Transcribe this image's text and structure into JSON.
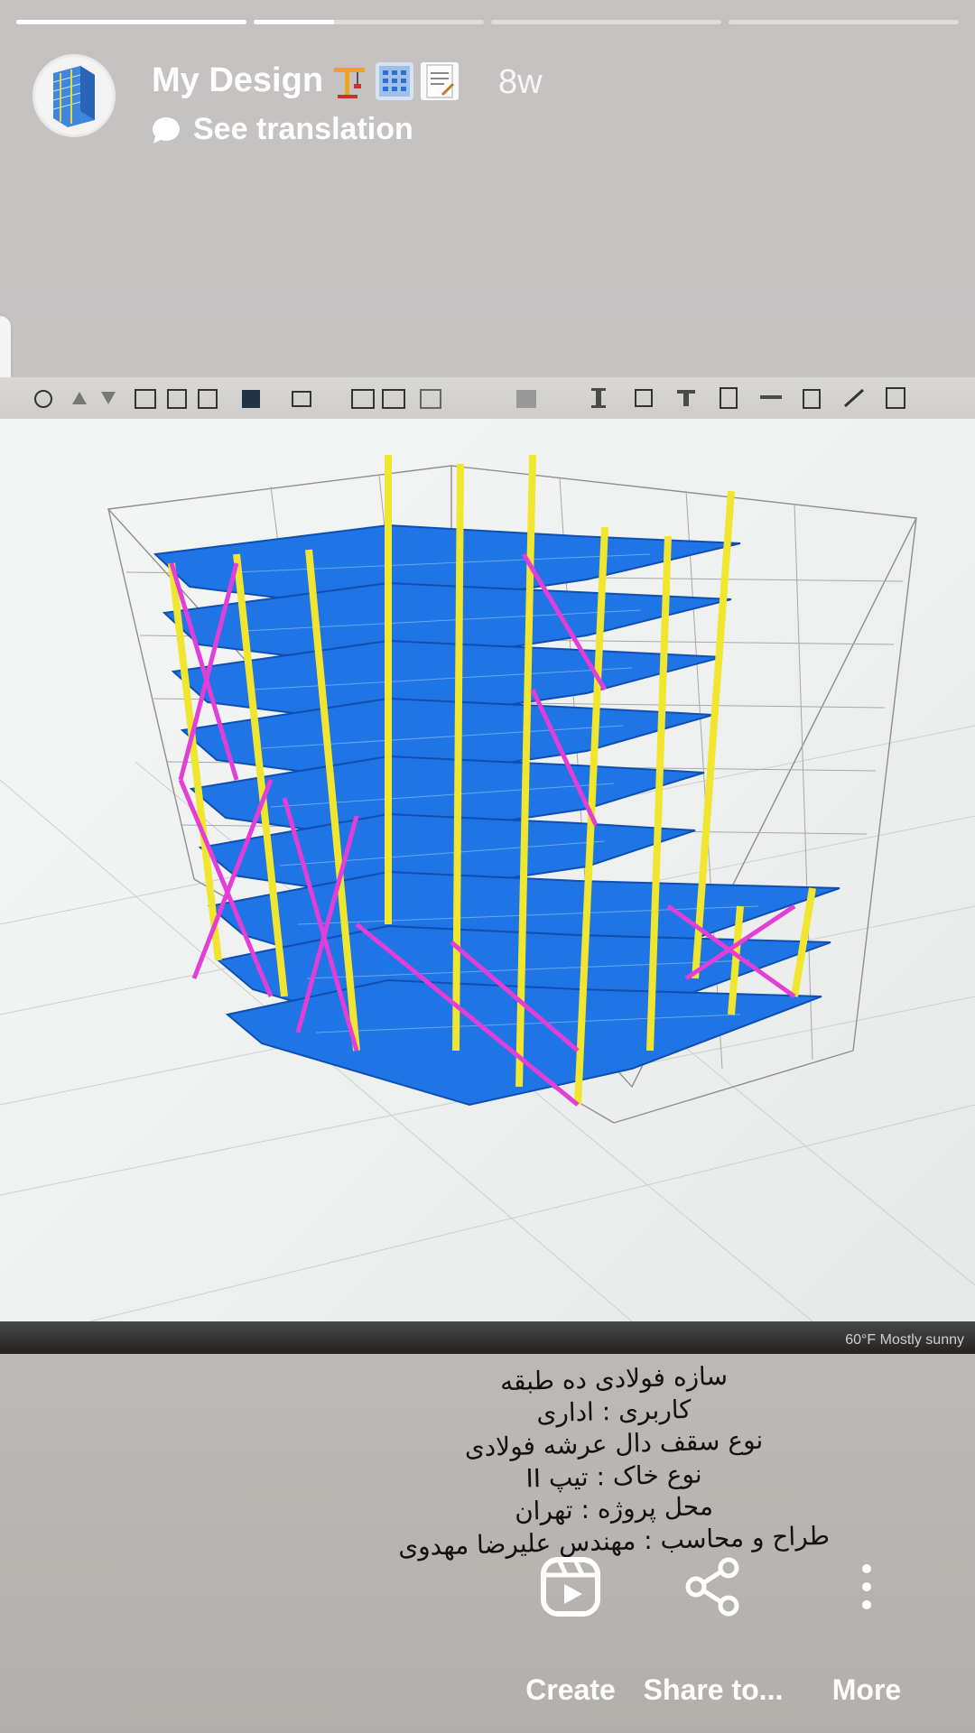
{
  "story": {
    "progress": [
      1,
      0.35,
      0,
      0
    ],
    "username": "My Design",
    "emojis": [
      "crane-emoji",
      "office-building-emoji",
      "document-emoji"
    ],
    "time_ago": "8w",
    "see_translation": "See translation"
  },
  "photo": {
    "weather": "60°F  Mostly sunny"
  },
  "caption": [
    "سازه فولادی ده طبقه",
    "کاربری : اداری",
    "نوع سقف دال عرشه فولادی",
    "نوع خاک : تیپ II",
    "محل پروژه : تهران",
    "طراح و محاسب : مهندس علیرضا مهدوی"
  ],
  "actions": {
    "create": "Create",
    "share": "Share to...",
    "more": "More"
  },
  "colors": {
    "beam": "#1f74e6",
    "column": "#f0e62e",
    "brace": "#e33fd8",
    "grid": "#9a9a9a"
  }
}
